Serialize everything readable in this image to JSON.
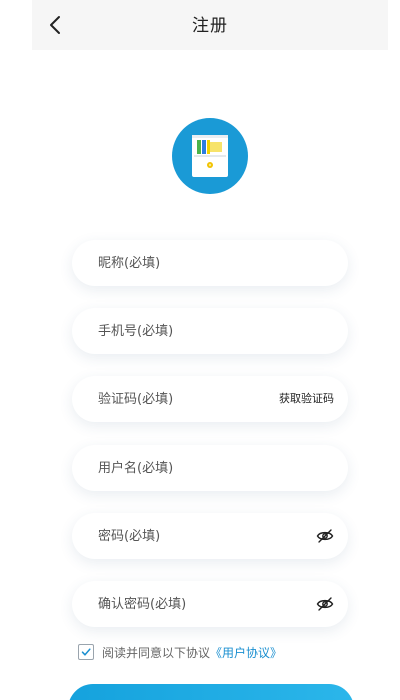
{
  "header": {
    "title": "注册",
    "back_icon": "chevron-left-icon"
  },
  "logo": {
    "icon": "app-logo-icon",
    "color": "#1a9ad6"
  },
  "form": {
    "nickname_placeholder": "昵称(必填)",
    "phone_placeholder": "手机号(必填)",
    "code_placeholder": "验证码(必填)",
    "get_code_label": "获取验证码",
    "username_placeholder": "用户名(必填)",
    "password_placeholder": "密码(必填)",
    "confirm_password_placeholder": "确认密码(必填)",
    "eye_icon": "eye-slash-icon"
  },
  "agreement": {
    "checked": true,
    "text": "阅读并同意以下协议",
    "link_text": "《用户协议》"
  },
  "colors": {
    "accent": "#1a9ad6",
    "link": "#1a8fd0"
  }
}
